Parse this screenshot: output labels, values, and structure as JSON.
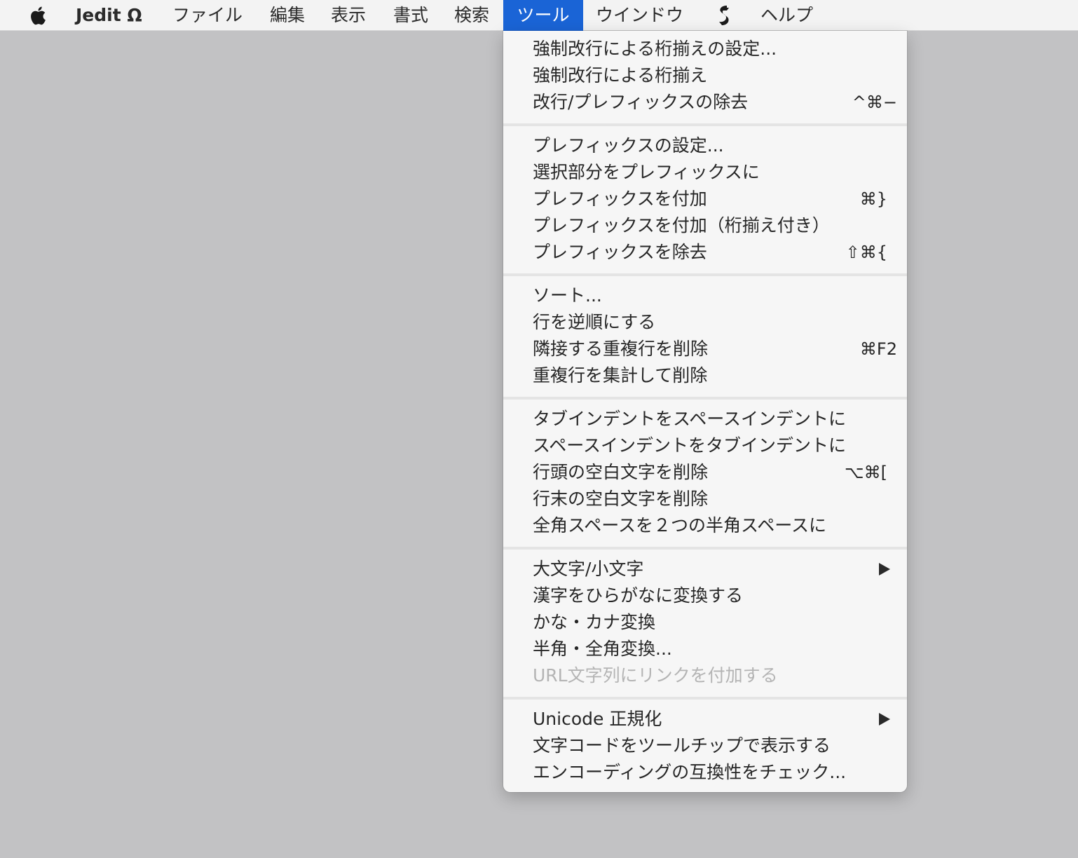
{
  "menubar": {
    "apple": "apple-icon",
    "app_name": "Jedit Ω",
    "items": [
      "ファイル",
      "編集",
      "表示",
      "書式",
      "検索",
      "ツール",
      "ウインドウ",
      "",
      "ヘルプ"
    ],
    "extra_icon": "script-icon"
  },
  "menu": {
    "title": "ツール",
    "groups": [
      [
        {
          "label": "強制改行による桁揃えの設定..."
        },
        {
          "label": "強制改行による桁揃え"
        },
        {
          "label": "改行/プレフィックスの除去",
          "shortcut": "^⌘−"
        }
      ],
      [
        {
          "label": "プレフィックスの設定..."
        },
        {
          "label": "選択部分をプレフィックスに"
        },
        {
          "label": "プレフィックスを付加",
          "shortcut": "⌘}"
        },
        {
          "label": "プレフィックスを付加（桁揃え付き）"
        },
        {
          "label": "プレフィックスを除去",
          "shortcut": "⇧⌘{"
        }
      ],
      [
        {
          "label": "ソート..."
        },
        {
          "label": "行を逆順にする"
        },
        {
          "label": "隣接する重複行を削除",
          "shortcut": "⌘F2"
        },
        {
          "label": "重複行を集計して削除"
        }
      ],
      [
        {
          "label": "タブインデントをスペースインデントに"
        },
        {
          "label": "スペースインデントをタブインデントに"
        },
        {
          "label": "行頭の空白文字を削除",
          "shortcut": "⌥⌘["
        },
        {
          "label": "行末の空白文字を削除"
        },
        {
          "label": "全角スペースを２つの半角スペースに"
        }
      ],
      [
        {
          "label": "大文字/小文字",
          "submenu": true
        },
        {
          "label": "漢字をひらがなに変換する"
        },
        {
          "label": "かな・カナ変換"
        },
        {
          "label": "半角・全角変換..."
        },
        {
          "label": "URL文字列にリンクを付加する",
          "disabled": true
        }
      ],
      [
        {
          "label": "Unicode 正規化",
          "submenu": true
        },
        {
          "label": "文字コードをツールチップで表示する"
        },
        {
          "label": "エンコーディングの互換性をチェック..."
        }
      ]
    ]
  }
}
